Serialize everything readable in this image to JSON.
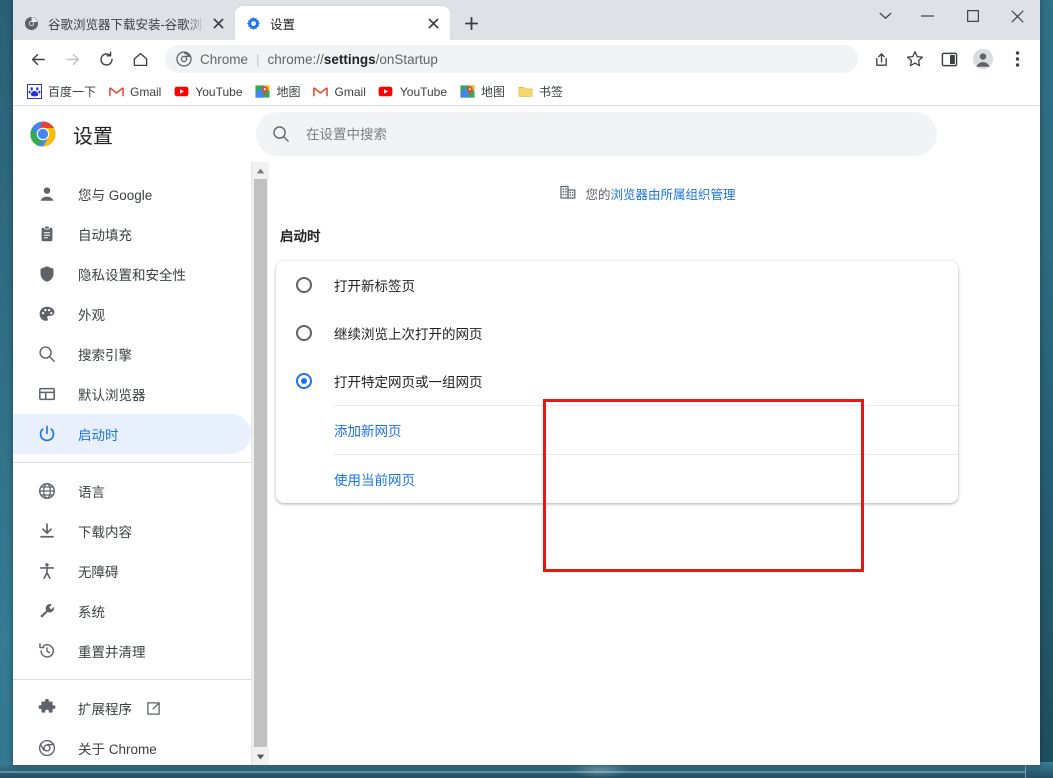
{
  "window": {
    "controls": [
      {
        "name": "tab-search",
        "glyph": "chevron-down-icon"
      },
      {
        "name": "minimize",
        "glyph": "minimize-icon"
      },
      {
        "name": "maximize",
        "glyph": "maximize-icon"
      },
      {
        "name": "close",
        "glyph": "close-icon"
      }
    ]
  },
  "tabs": [
    {
      "title": "谷歌浏览器下载安装-谷歌浏览器",
      "favicon": "globe-gray-icon",
      "active": false
    },
    {
      "title": "设置",
      "favicon": "settings-gear-icon",
      "active": true
    }
  ],
  "new_tab_label": "+",
  "toolbar": {
    "back": "back-arrow-icon",
    "forward": "forward-arrow-icon",
    "reload": "reload-icon",
    "home": "home-icon",
    "omnibox": {
      "chip_label": "Chrome",
      "separator": "|",
      "url_prefix": "chrome://",
      "url_bold": "settings",
      "url_suffix": "/onStartup",
      "full_url": "chrome://settings/onStartup"
    },
    "right_icons": [
      {
        "name": "share-icon"
      },
      {
        "name": "star-bookmark-icon"
      },
      {
        "name": "side-panel-icon"
      },
      {
        "name": "profile-avatar-icon"
      },
      {
        "name": "more-menu-icon"
      }
    ]
  },
  "bookmarks": [
    {
      "label": "百度一下",
      "icon": "baidu-icon"
    },
    {
      "label": "Gmail",
      "icon": "gmail-icon"
    },
    {
      "label": "YouTube",
      "icon": "youtube-icon"
    },
    {
      "label": "地图",
      "icon": "maps-icon"
    },
    {
      "label": "Gmail",
      "icon": "gmail-icon"
    },
    {
      "label": "YouTube",
      "icon": "youtube-icon"
    },
    {
      "label": "地图",
      "icon": "maps-icon"
    },
    {
      "label": "书签",
      "icon": "folder-icon"
    }
  ],
  "settings": {
    "brand_title": "设置",
    "brand_logo": "chrome-logo-icon",
    "search": {
      "placeholder": "在设置中搜索",
      "value": "",
      "icon": "search-icon"
    },
    "sidebar_groups": [
      {
        "items": [
          {
            "label": "您与 Google",
            "icon": "person-icon",
            "selected": false
          },
          {
            "label": "自动填充",
            "icon": "clipboard-icon",
            "selected": false
          },
          {
            "label": "隐私设置和安全性",
            "icon": "shield-icon",
            "selected": false
          },
          {
            "label": "外观",
            "icon": "palette-icon",
            "selected": false
          },
          {
            "label": "搜索引擎",
            "icon": "search-icon",
            "selected": false
          },
          {
            "label": "默认浏览器",
            "icon": "browser-window-icon",
            "selected": false
          },
          {
            "label": "启动时",
            "icon": "power-icon",
            "selected": true
          }
        ]
      },
      {
        "items": [
          {
            "label": "语言",
            "icon": "globe-icon",
            "selected": false
          },
          {
            "label": "下载内容",
            "icon": "download-icon",
            "selected": false
          },
          {
            "label": "无障碍",
            "icon": "accessibility-icon",
            "selected": false
          },
          {
            "label": "系统",
            "icon": "wrench-icon",
            "selected": false
          },
          {
            "label": "重置并清理",
            "icon": "restore-icon",
            "selected": false
          }
        ]
      },
      {
        "items": [
          {
            "label": "扩展程序",
            "icon": "puzzle-icon",
            "selected": false,
            "external": true,
            "external_icon": "external-link-icon"
          },
          {
            "label": "关于 Chrome",
            "icon": "chrome-outline-icon",
            "selected": false
          }
        ]
      }
    ],
    "managed_notice": {
      "icon": "organization-building-icon",
      "prefix": "您的",
      "link": "浏览器由所属组织管理"
    },
    "section_title": "启动时",
    "startup_options": [
      {
        "label": "打开新标签页",
        "selected": false
      },
      {
        "label": "继续浏览上次打开的网页",
        "selected": false
      },
      {
        "label": "打开特定网页或一组网页",
        "selected": true
      }
    ],
    "startup_links": [
      {
        "label": "添加新网页"
      },
      {
        "label": "使用当前网页"
      }
    ]
  },
  "annotation": {
    "color": "#e01b15",
    "shape": "rectangle"
  },
  "colors": {
    "accent_blue": "#1a73e8",
    "selected_bg": "#e8f0fe",
    "tabstrip_bg": "#dee1e6",
    "annotation_red": "#e01b15",
    "desktop_teal": "#2f6f86"
  }
}
